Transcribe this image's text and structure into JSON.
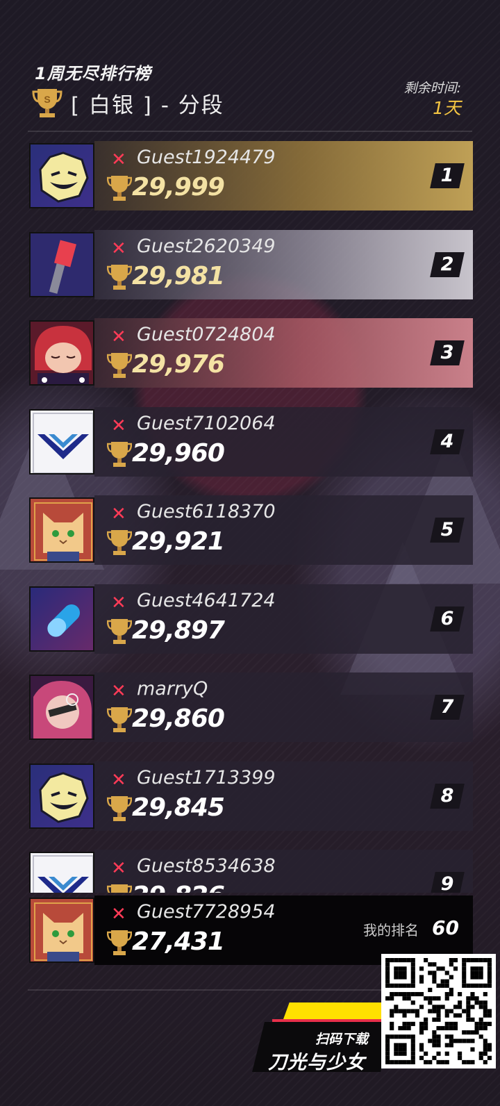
{
  "header": {
    "title": "1周无尽排行榜",
    "tier_label": "[ 白银 ] - 分段",
    "remain_label": "剩余时间:",
    "remain_value": "1天"
  },
  "leaderboard": [
    {
      "rank": "1",
      "name": "Guest1924479",
      "score": "29,999",
      "avatar": "grin-mask-avatar"
    },
    {
      "rank": "2",
      "name": "Guest2620349",
      "score": "29,981",
      "avatar": "hammer-avatar"
    },
    {
      "rank": "3",
      "name": "Guest0724804",
      "score": "29,976",
      "avatar": "red-hair-girl-avatar"
    },
    {
      "rank": "4",
      "name": "Guest7102064",
      "score": "29,960",
      "avatar": "v-emblem-avatar"
    },
    {
      "rank": "5",
      "name": "Guest6118370",
      "score": "29,921",
      "avatar": "owl-avatar"
    },
    {
      "rank": "6",
      "name": "Guest4641724",
      "score": "29,897",
      "avatar": "pill-avatar"
    },
    {
      "rank": "7",
      "name": "marryQ",
      "score": "29,860",
      "avatar": "pink-hair-girl-avatar"
    },
    {
      "rank": "8",
      "name": "Guest1713399",
      "score": "29,845",
      "avatar": "grin-mask-avatar"
    },
    {
      "rank": "9",
      "name": "Guest8534638",
      "score": "29,826",
      "avatar": "v-emblem-avatar"
    }
  ],
  "me": {
    "name": "Guest7728954",
    "score": "27,431",
    "rank_label": "我的排名",
    "rank": "60",
    "avatar": "owl-avatar"
  },
  "promo": {
    "scan_text": "扫码下载",
    "game_name": "刀光与少女"
  },
  "colors": {
    "accent_gold": "#f5c542",
    "x_mark_red": "#ff3b57",
    "rank1_bar": "#bfa056",
    "rank2_bar": "#c8c4cc",
    "rank3_bar": "#c9808a"
  }
}
